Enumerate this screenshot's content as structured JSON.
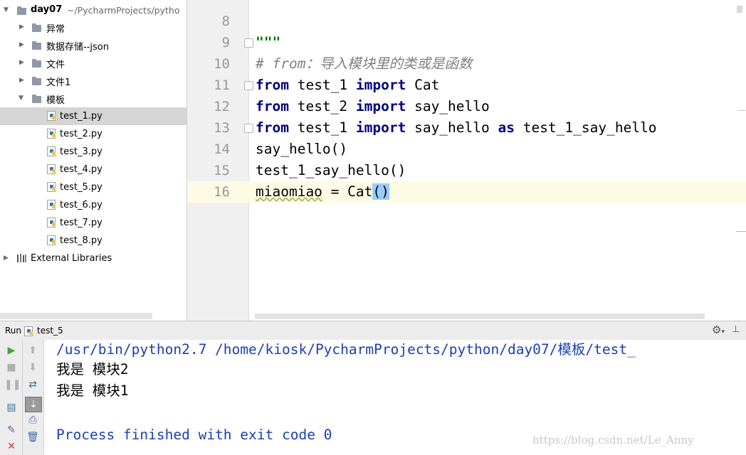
{
  "project": {
    "root_name": "day07",
    "root_path": "~/PycharmProjects/pytho",
    "items": [
      {
        "label": "异常",
        "type": "folder"
      },
      {
        "label": "数据存储--json",
        "type": "folder"
      },
      {
        "label": "文件",
        "type": "folder"
      },
      {
        "label": "文件1",
        "type": "folder"
      },
      {
        "label": "模板",
        "type": "folder"
      },
      {
        "label": "test_1.py",
        "type": "file"
      },
      {
        "label": "test_2.py",
        "type": "file"
      },
      {
        "label": "test_3.py",
        "type": "file"
      },
      {
        "label": "test_4.py",
        "type": "file"
      },
      {
        "label": "test_5.py",
        "type": "file"
      },
      {
        "label": "test_6.py",
        "type": "file"
      },
      {
        "label": "test_7.py",
        "type": "file"
      },
      {
        "label": "test_8.py",
        "type": "file"
      }
    ],
    "external_libraries": "External Libraries"
  },
  "editor": {
    "line_numbers": [
      "8",
      "9",
      "10",
      "11",
      "12",
      "13",
      "14",
      "15",
      "16"
    ],
    "lines": {
      "l9_docstring": "\"\"\"",
      "l10_comment": "# from：导入模块里的类或是函数",
      "l11": {
        "kw1": "from",
        "mod": " test_1 ",
        "kw2": "import",
        "name": " Cat"
      },
      "l12": {
        "kw1": "from",
        "mod": " test_2 ",
        "kw2": "import",
        "name": " say_hello"
      },
      "l13": {
        "kw1": "from",
        "mod": " test_1 ",
        "kw2": "import",
        "name": " say_hello ",
        "kw3": "as",
        "alias": " test_1_say_hello"
      },
      "l14": "say_hello()",
      "l15": "test_1_say_hello()",
      "l16": {
        "var": "miaomiao",
        "rest": " = Cat",
        "parens": "()"
      }
    }
  },
  "run": {
    "label": "Run",
    "tab": "test_5",
    "console": {
      "command": "/usr/bin/python2.7 /home/kiosk/PycharmProjects/python/day07/模板/test_",
      "output1": "我是 模块2",
      "output2": "我是 模块1",
      "finished": "Process finished with exit code 0"
    }
  },
  "watermark": "https://blog.csdn.net/Le_Anny",
  "colors": {
    "keyword": "#000080",
    "comment": "#808080",
    "console_blue": "#1c3fb3",
    "current_line": "#fffae3",
    "selected_row": "#d5d5d5"
  }
}
